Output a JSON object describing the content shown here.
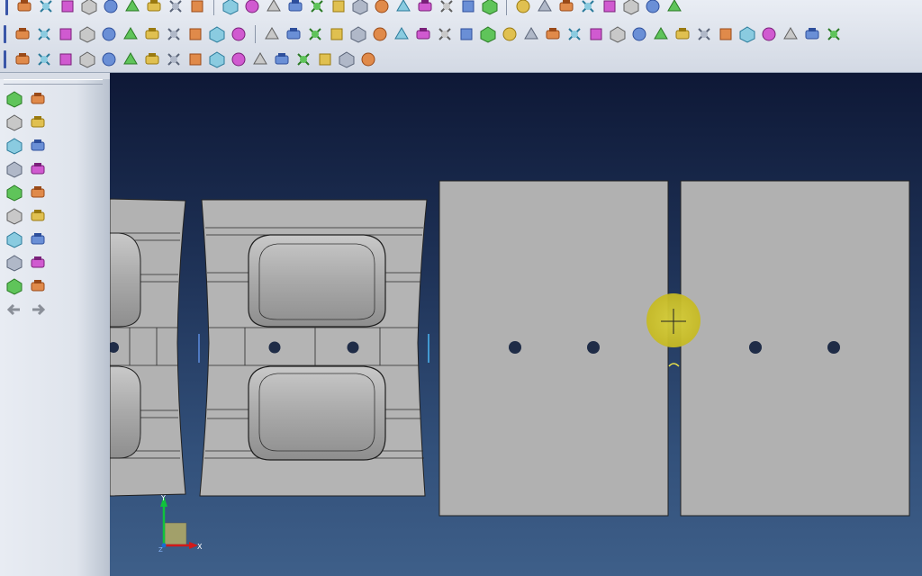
{
  "toolbar_row1_icons": [
    "new-file-icon",
    "open-file-icon",
    "open-folder-icon",
    "save-icon",
    "save-as-icon",
    "import-icon",
    "print-icon",
    "zoom-icon",
    "display-icon",
    "select-icon",
    "measure-icon",
    "rotate-icon",
    "transform-icon",
    "pan-icon",
    "wire-box-icon",
    "solid-box-green-icon",
    "cube-outline-icon",
    "cube-green-icon",
    "cube-front-icon",
    "cube-back-icon",
    "cube-solid-icon",
    "scale-1-1-icon",
    "view-list-icon",
    "shade-icon",
    "render-icon",
    "mesh-icon",
    "chain-icon",
    "filter-icon",
    "analyze-icon",
    "plus-minus-icon"
  ],
  "toolbar_row2_icons": [
    "part-box-icon",
    "part-blue-icon",
    "part-yellow-icon",
    "part-assembly-icon",
    "part-tool-icon",
    "part-stack-icon",
    "part-link-icon",
    "part-copy-icon",
    "part-move-icon",
    "part-delete-icon",
    "part-property-icon",
    "cube-icon",
    "cylinder-icon",
    "cylinder-tall-icon",
    "cone-icon",
    "sphere-icon",
    "torus-icon",
    "ring-icon",
    "ring-green-icon",
    "shell-icon",
    "block-icon",
    "block-alt-icon",
    "skew-icon",
    "extrude-icon",
    "loft-icon",
    "sweep-icon",
    "revolve-icon",
    "mirror-icon",
    "offset-icon",
    "fillet-icon",
    "chamfer-icon",
    "section-icon",
    "boolean-icon",
    "union-icon",
    "subtract-icon",
    "intersect-icon",
    "split-icon",
    "trim-icon"
  ],
  "toolbar_row3_icons": [
    "surface-icon",
    "surface-patch-icon",
    "surface-blend-icon",
    "surface-diamond-icon",
    "fix-h2-icon",
    "surface-flip-icon",
    "surface-grid-icon",
    "surface-cut-icon",
    "surface-roll-icon",
    "surface-link-icon",
    "surface-face-icon",
    "surface-stack-icon",
    "surface-solid-icon",
    "surface-node-icon",
    "surface-mesh-icon",
    "surface-network-icon",
    "surface-seam-icon"
  ],
  "left_toolbar_icons": [
    "zoom-fit-icon",
    "pick-icon",
    "bounding-icon",
    "corner-icon",
    "search-part-icon",
    "edit-icon",
    "align-icon",
    "pencil-icon",
    "paint-icon",
    "panel-icon",
    "refresh-icon",
    "solid-cube-icon",
    "help-icon",
    "dimension-icon",
    "trash-icon",
    "undo-icon",
    "filter-icon",
    "folder-icon",
    "back-arrow-icon",
    "forward-arrow-icon"
  ],
  "viewport": {
    "axis_y_label": "Y",
    "axis_x_label": "X",
    "axis_z_label": "Z"
  }
}
